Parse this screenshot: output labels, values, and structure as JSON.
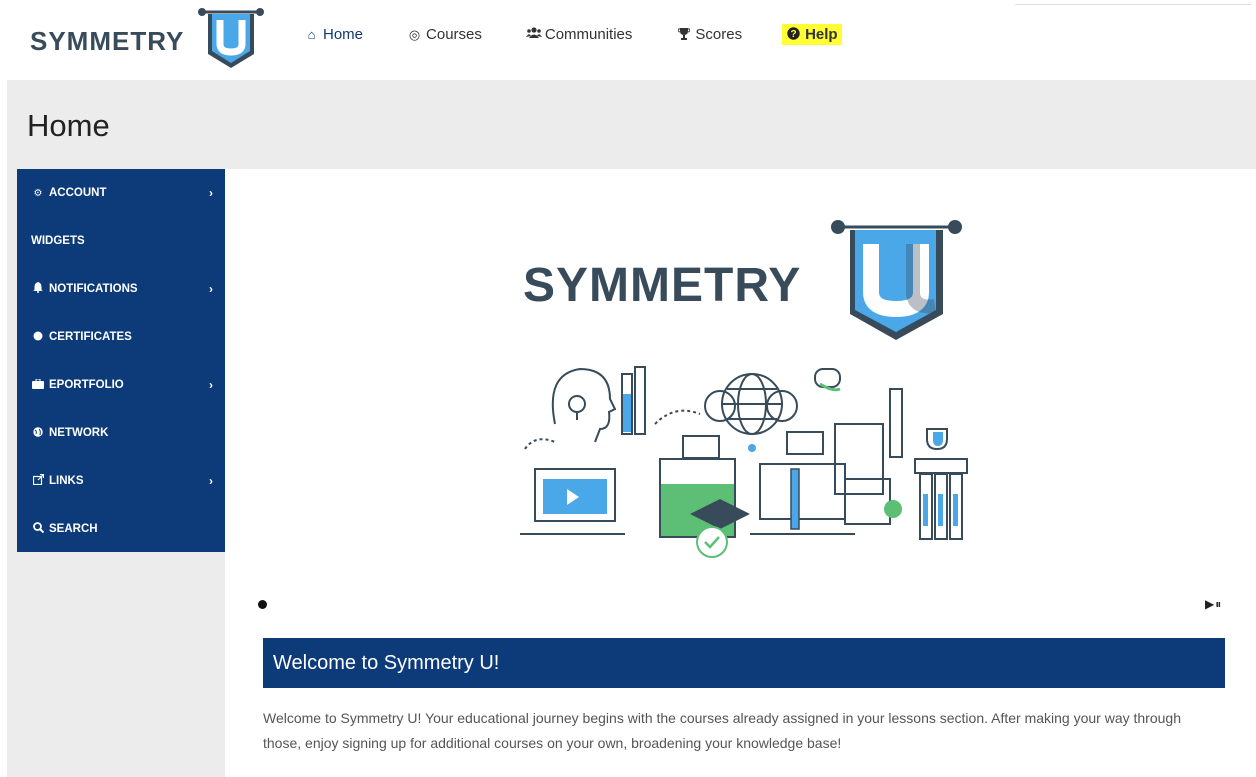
{
  "brand": {
    "name": "SYMMETRY",
    "letter": "U"
  },
  "nav": [
    {
      "label": "Home",
      "icon": "home-icon",
      "glyph": "⌂"
    },
    {
      "label": "Courses",
      "icon": "compass-icon",
      "glyph": "◎"
    },
    {
      "label": "Communities",
      "icon": "users-icon",
      "glyph": "👥"
    },
    {
      "label": "Scores",
      "icon": "trophy-icon",
      "glyph": "🏆"
    },
    {
      "label": "Help",
      "icon": "question-circle-icon",
      "glyph": "❓"
    }
  ],
  "page": {
    "title": "Home"
  },
  "sidebar": {
    "items": [
      {
        "label": "ACCOUNT",
        "icon": "cogs-icon",
        "glyph": "⚙",
        "has_submenu": true
      },
      {
        "label": "WIDGETS",
        "icon": "",
        "glyph": "",
        "has_submenu": false
      },
      {
        "label": "NOTIFICATIONS",
        "icon": "bell-icon",
        "glyph": "🔔",
        "has_submenu": true
      },
      {
        "label": "CERTIFICATES",
        "icon": "certificate-icon",
        "glyph": "✹",
        "has_submenu": false
      },
      {
        "label": "EPORTFOLIO",
        "icon": "briefcase-icon",
        "glyph": "💼",
        "has_submenu": true
      },
      {
        "label": "NETWORK",
        "icon": "globe-icon",
        "glyph": "🌐",
        "has_submenu": false
      },
      {
        "label": "LINKS",
        "icon": "external-link-icon",
        "glyph": "↗",
        "has_submenu": true
      },
      {
        "label": "SEARCH",
        "icon": "search-icon",
        "glyph": "🔍",
        "has_submenu": false
      }
    ],
    "chevron": "›"
  },
  "carousel": {
    "controls": "▶⏸"
  },
  "welcome": {
    "title": "Welcome to Symmetry U!",
    "body": "Welcome to Symmetry U! Your educational journey begins with the courses already assigned in your lessons section. After making your way through those, enjoy signing up for additional courses on your own, broadening your knowledge base!"
  },
  "colors": {
    "navy": "#0d3b7a",
    "shield_blue": "#4aa8e8",
    "shield_dark": "#384b5a",
    "help_highlight": "#ffff33"
  }
}
